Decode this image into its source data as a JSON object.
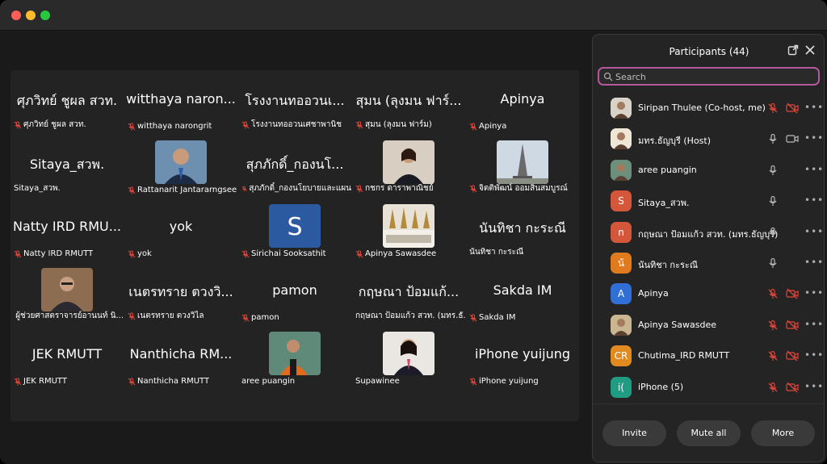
{
  "window": {
    "controls": [
      "close",
      "minimize",
      "maximize"
    ]
  },
  "tiles": [
    {
      "big": "ศุภวิทย์ ชูผล สวท.",
      "name": "ศุภวิทย์ ชูผล สวท.",
      "muted": true,
      "photo": null
    },
    {
      "big": "witthaya naron...",
      "name": "witthaya narongrit",
      "muted": true,
      "photo": null
    },
    {
      "big": "โรงงานทออวนเ...",
      "name": "โรงงานทออวนเศชาพานิช",
      "muted": true,
      "photo": null
    },
    {
      "big": "สุมน (ลุงมน ฟาร์...",
      "name": "สุมน (ลุงมน ฟาร์ม)",
      "muted": true,
      "photo": null
    },
    {
      "big": "Apinya",
      "name": "Apinya",
      "muted": true,
      "photo": null
    },
    {
      "big": "Sitaya_สวพ.",
      "name": "Sitaya_สวพ.",
      "muted": false,
      "photo": null
    },
    {
      "big": "",
      "name": "Rattanarit Jantararngsee",
      "muted": true,
      "photo": "man-suit"
    },
    {
      "big": "สุภภักดิ์_กองนโ...",
      "name": "สุภภักดิ์_กองนโยบายและแผน",
      "muted": true,
      "photo": null
    },
    {
      "big": "",
      "name": "กชกร ดาราพาณิชย์",
      "muted": true,
      "photo": "woman-dark"
    },
    {
      "big": "",
      "name": "จิตติพัฒน์ ออมสินสมบูรณ์",
      "muted": true,
      "photo": "eiffel"
    },
    {
      "big": "Natty IRD RMU...",
      "name": "Natty IRD RMUTT",
      "muted": true,
      "photo": null
    },
    {
      "big": "yok",
      "name": "yok",
      "muted": true,
      "photo": null
    },
    {
      "big": "",
      "name": "Sirichai Sooksathit",
      "muted": true,
      "photo": "letter-s"
    },
    {
      "big": "",
      "name": "Apinya Sawasdee",
      "muted": true,
      "photo": "temple"
    },
    {
      "big": "นันทิชา กะระณี",
      "name": "นันทิชา กะระณี",
      "muted": false,
      "photo": null
    },
    {
      "big": "",
      "name": "ผู้ช่วยศาสตราจารย์อานนท์ นิ...",
      "muted": true,
      "photo": "man-glasses"
    },
    {
      "big": "เนตรทราย ตวงวิ...",
      "name": "เนตรทราย ตวงวิไล",
      "muted": true,
      "photo": null
    },
    {
      "big": "pamon",
      "name": "pamon",
      "muted": true,
      "photo": null
    },
    {
      "big": "กฤษณา ป้อมแก้...",
      "name": "กฤษณา ป้อมแก้ว สวท. (มทร.ธั...",
      "muted": false,
      "photo": null
    },
    {
      "big": "Sakda IM",
      "name": "Sakda IM",
      "muted": true,
      "photo": null
    },
    {
      "big": "JEK RMUTT",
      "name": "JEK RMUTT",
      "muted": true,
      "photo": null
    },
    {
      "big": "Nanthicha RM...",
      "name": "Nanthicha RMUTT",
      "muted": true,
      "photo": null
    },
    {
      "big": "",
      "name": "aree puangin",
      "muted": false,
      "photo": "lifejacket"
    },
    {
      "big": "",
      "name": "Supawinee",
      "muted": false,
      "photo": "woman-red"
    },
    {
      "big": "iPhone yuijung",
      "name": "iPhone yuijung",
      "muted": true,
      "photo": null
    }
  ],
  "panel": {
    "title": "Participants (44)",
    "search_placeholder": "Search",
    "participants": [
      {
        "name": "Siripan Thulee (Co-host, me)",
        "avatar_letter": "",
        "avatar_color": "#d9d2c8",
        "mic": "muted",
        "cam": "off"
      },
      {
        "name": "มทร.ธัญบุรี (Host)",
        "avatar_letter": "",
        "avatar_color": "#f0e6d6",
        "mic": "on",
        "cam": "on"
      },
      {
        "name": "aree puangin",
        "avatar_letter": "",
        "avatar_color": "#6b8f7a",
        "mic": "on",
        "cam": "none"
      },
      {
        "name": "Sitaya_สวพ.",
        "avatar_letter": "S",
        "avatar_color": "#d5573b",
        "mic": "on",
        "cam": "none"
      },
      {
        "name": "กฤษณา  ป้อมแก้ว สวท. (มทร.ธัญบุรี)",
        "avatar_letter": "n",
        "avatar_color": "#d5573b",
        "mic": "on",
        "cam": "none"
      },
      {
        "name": "นันทิชา กะระณี",
        "avatar_letter": "น้",
        "avatar_color": "#e07a1f",
        "mic": "on",
        "cam": "none"
      },
      {
        "name": "Apinya",
        "avatar_letter": "A",
        "avatar_color": "#2f6fd6",
        "mic": "muted",
        "cam": "off"
      },
      {
        "name": "Apinya Sawasdee",
        "avatar_letter": "",
        "avatar_color": "#c9b590",
        "mic": "muted",
        "cam": "off"
      },
      {
        "name": "Chutima_IRD RMUTT",
        "avatar_letter": "CR",
        "avatar_color": "#e08a1f",
        "mic": "muted",
        "cam": "off"
      },
      {
        "name": "iPhone (5)",
        "avatar_letter": "i(",
        "avatar_color": "#1f9c82",
        "mic": "muted",
        "cam": "off"
      }
    ],
    "buttons": {
      "invite": "Invite",
      "mute_all": "Mute all",
      "more": "More"
    }
  },
  "colors": {
    "mute_red": "#e0453a",
    "search_border": "#b5579b"
  }
}
